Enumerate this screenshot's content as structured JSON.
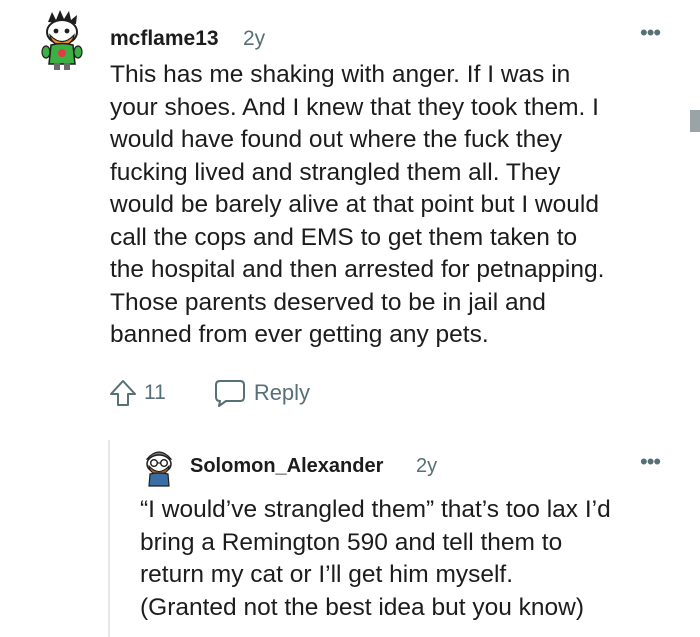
{
  "comments": [
    {
      "username": "mcflame13",
      "age": "2y",
      "avatar_icon": "snoo-avatar-icon",
      "body": "This has me shaking with anger. If I was in\nyour shoes. And I knew that they took them. I\nwould have found out where the fuck they\nfucking lived and strangled them all. They\nwould be barely alive at that point but I would\ncall the cops and EMS to get them taken to\nthe hospital and then arrested for petnapping.\nThose parents deserved to be in jail and\nbanned from ever getting any pets.",
      "votes": "11",
      "reply_label": "Reply",
      "more_label": "•••"
    },
    {
      "username": "Solomon_Alexander",
      "age": "2y",
      "avatar_icon": "snoo-avatar-icon",
      "body": "“I would’ve strangled them” that’s too lax I’d\nbring a Remington 590 and tell them to\nreturn my cat or I’ll get him myself.\n(Granted not the best idea but you know)",
      "more_label": "•••"
    }
  ],
  "colors": {
    "text": "#1c1c1c",
    "meta": "#576f76",
    "thread_line": "#e4e8ea"
  },
  "icons": {
    "upvote": "upvote-arrow-icon",
    "reply": "speech-bubble-icon",
    "more": "overflow-menu-icon"
  }
}
